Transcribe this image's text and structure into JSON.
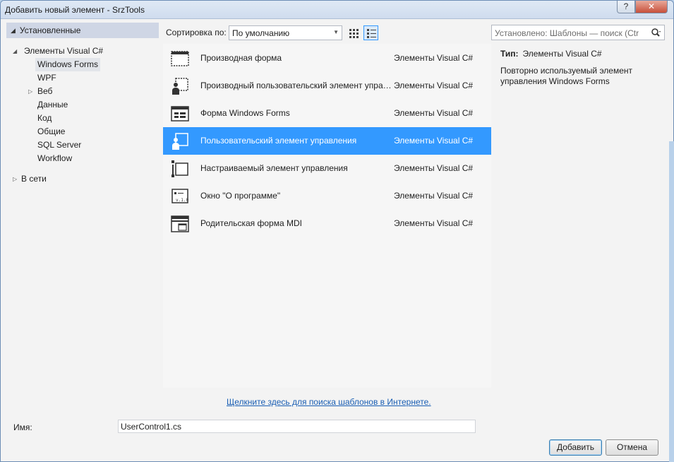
{
  "window": {
    "title": "Добавить новый элемент - SrzTools",
    "help": "?",
    "close": "✕"
  },
  "left": {
    "header": "Установленные",
    "tree": [
      {
        "label": "Элементы Visual C#",
        "expander": "◢",
        "level": 0
      },
      {
        "label": "Windows Forms",
        "expander": "",
        "level": 1,
        "selected": true
      },
      {
        "label": "WPF",
        "expander": "",
        "level": 1
      },
      {
        "label": "Веб",
        "expander": "▷",
        "level": 1
      },
      {
        "label": "Данные",
        "expander": "",
        "level": 1
      },
      {
        "label": "Код",
        "expander": "",
        "level": 1
      },
      {
        "label": "Общие",
        "expander": "",
        "level": 1
      },
      {
        "label": "SQL Server",
        "expander": "",
        "level": 1
      },
      {
        "label": "Workflow",
        "expander": "",
        "level": 1
      }
    ],
    "online": {
      "label": "В сети",
      "expander": "▷"
    }
  },
  "toolbar": {
    "sort_label": "Сортировка по:",
    "sort_value": "По умолчанию",
    "search_placeholder": "Установлено: Шаблоны — поиск (Ctr"
  },
  "items": [
    {
      "name": "Производная форма",
      "category": "Элементы Visual C#",
      "icon": "inherited-form-icon"
    },
    {
      "name": "Производный пользовательский элемент управления",
      "category": "Элементы Visual C#",
      "icon": "inherited-user-control-icon"
    },
    {
      "name": "Форма Windows Forms",
      "category": "Элементы Visual C#",
      "icon": "windows-form-icon"
    },
    {
      "name": "Пользовательский элемент управления",
      "category": "Элементы Visual C#",
      "icon": "user-control-icon",
      "selected": true
    },
    {
      "name": "Настраиваемый элемент управления",
      "category": "Элементы Visual C#",
      "icon": "custom-control-icon"
    },
    {
      "name": "Окно \"О программе\"",
      "category": "Элементы Visual C#",
      "icon": "about-box-icon"
    },
    {
      "name": "Родительская форма MDI",
      "category": "Элементы Visual C#",
      "icon": "mdi-parent-form-icon"
    }
  ],
  "info": {
    "type_label": "Тип:",
    "type_value": "Элементы Visual C#",
    "description": "Повторно используемый элемент управления Windows Forms"
  },
  "online_link": "Щелкните здесь для поиска шаблонов в Интернете.",
  "name_field": {
    "label": "Имя:",
    "value": "UserControl1.cs"
  },
  "buttons": {
    "add": "Добавить",
    "cancel": "Отмена"
  },
  "colors": {
    "selection": "#3399ff",
    "link": "#1a5fb4"
  }
}
